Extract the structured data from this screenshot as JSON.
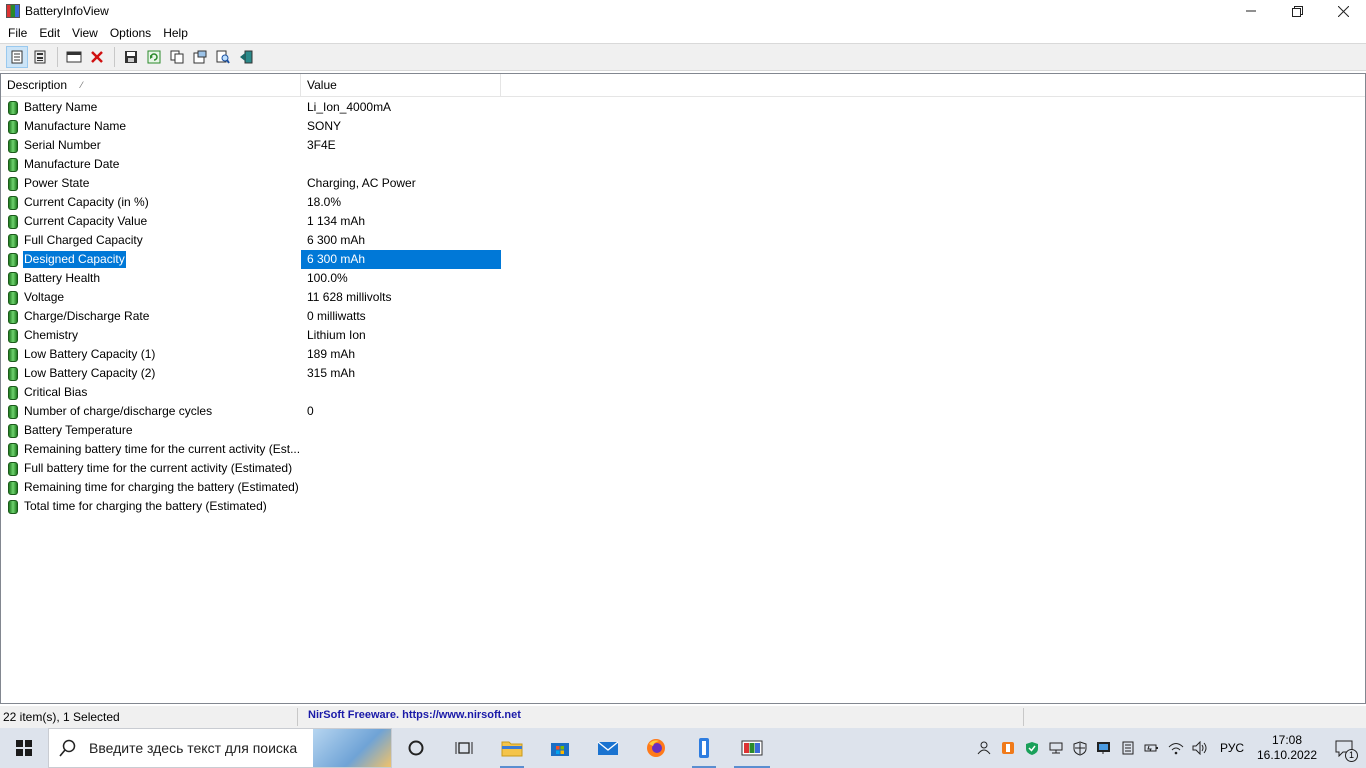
{
  "window": {
    "title": "BatteryInfoView"
  },
  "menu": [
    "File",
    "Edit",
    "View",
    "Options",
    "Help"
  ],
  "list": {
    "columns": [
      "Description",
      "Value"
    ],
    "sort_indicator": "⁄",
    "rows": [
      {
        "desc": "Battery Name",
        "value": "Li_Ion_4000mA"
      },
      {
        "desc": "Manufacture Name",
        "value": "SONY"
      },
      {
        "desc": "Serial Number",
        "value": "3F4E"
      },
      {
        "desc": "Manufacture Date",
        "value": ""
      },
      {
        "desc": "Power State",
        "value": "Charging, AC Power"
      },
      {
        "desc": "Current Capacity (in %)",
        "value": "18.0%"
      },
      {
        "desc": "Current Capacity Value",
        "value": "1 134 mAh"
      },
      {
        "desc": "Full Charged Capacity",
        "value": "6 300 mAh"
      },
      {
        "desc": "Designed Capacity",
        "value": "6 300 mAh",
        "selected": true
      },
      {
        "desc": "Battery Health",
        "value": "100.0%"
      },
      {
        "desc": "Voltage",
        "value": "11 628 millivolts"
      },
      {
        "desc": "Charge/Discharge Rate",
        "value": "0 milliwatts"
      },
      {
        "desc": "Chemistry",
        "value": "Lithium Ion"
      },
      {
        "desc": "Low Battery Capacity (1)",
        "value": "189 mAh"
      },
      {
        "desc": "Low Battery Capacity (2)",
        "value": "315 mAh"
      },
      {
        "desc": "Critical Bias",
        "value": ""
      },
      {
        "desc": "Number of charge/discharge cycles",
        "value": "0"
      },
      {
        "desc": "Battery Temperature",
        "value": ""
      },
      {
        "desc": "Remaining battery time for the current activity (Est...",
        "value": ""
      },
      {
        "desc": "Full battery time for the current activity (Estimated)",
        "value": ""
      },
      {
        "desc": "Remaining time for charging the battery (Estimated)",
        "value": ""
      },
      {
        "desc": "Total  time for charging the battery (Estimated)",
        "value": ""
      }
    ]
  },
  "status": {
    "count": "22 item(s), 1 Selected",
    "link": "NirSoft Freeware. https://www.nirsoft.net"
  },
  "taskbar": {
    "search_placeholder": "Введите здесь текст для поиска",
    "apps": [
      "task-view",
      "file-explorer",
      "store",
      "mail",
      "firefox",
      "app-blue",
      "batteryinfoview"
    ],
    "tray": {
      "lang": "РУС",
      "time": "17:08",
      "date": "16.10.2022",
      "notifications": "1"
    }
  },
  "colors": {
    "selection": "#0078d7",
    "taskbar": "#dde3ec",
    "link": "#1a1aa8"
  }
}
